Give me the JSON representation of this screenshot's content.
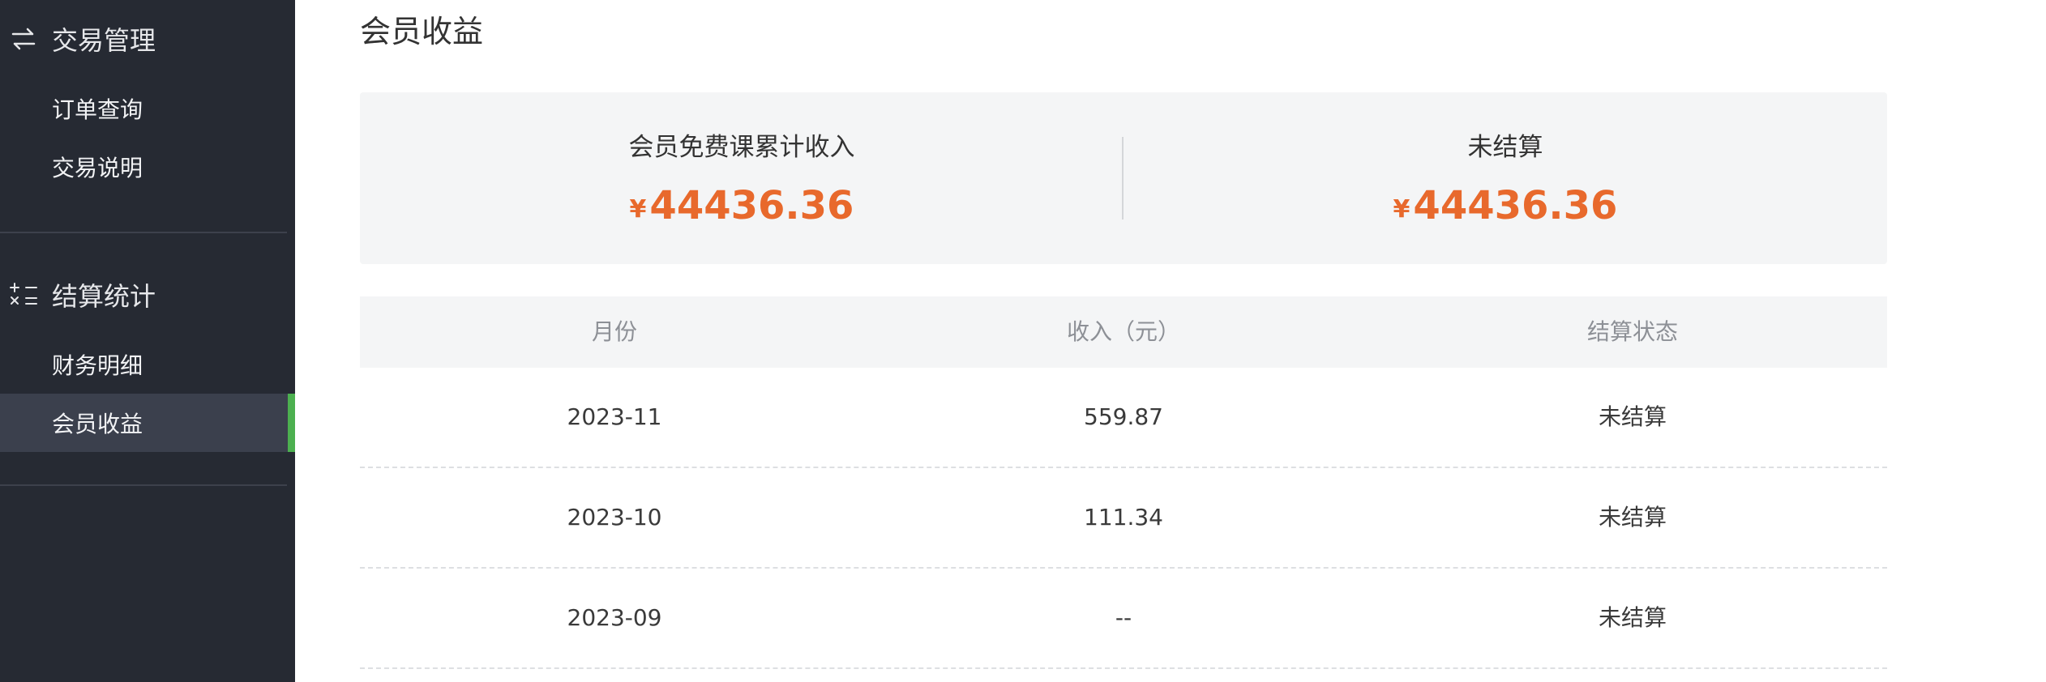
{
  "sidebar": {
    "groups": [
      {
        "icon": "swap-arrows-icon",
        "title": "交易管理",
        "items": [
          {
            "label": "订单查询",
            "active": false
          },
          {
            "label": "交易说明",
            "active": false
          }
        ]
      },
      {
        "icon": "calculator-icon",
        "title": "结算统计",
        "items": [
          {
            "label": "财务明细",
            "active": false
          },
          {
            "label": "会员收益",
            "active": true
          }
        ]
      }
    ],
    "active_color": "#4cb050",
    "bg_color": "#262a33"
  },
  "main": {
    "page_title": "会员收益",
    "summary": {
      "currency_symbol": "¥",
      "left": {
        "label": "会员免费课累计收入",
        "amount": "44436.36"
      },
      "right": {
        "label": "未结算",
        "amount": "44436.36"
      },
      "amount_color": "#e8692c"
    },
    "table": {
      "columns": [
        "月份",
        "收入（元）",
        "结算状态"
      ],
      "rows": [
        {
          "month": "2023-11",
          "income": "559.87",
          "status": "未结算"
        },
        {
          "month": "2023-10",
          "income": "111.34",
          "status": "未结算"
        },
        {
          "month": "2023-09",
          "income": "--",
          "status": "未结算"
        }
      ]
    }
  }
}
